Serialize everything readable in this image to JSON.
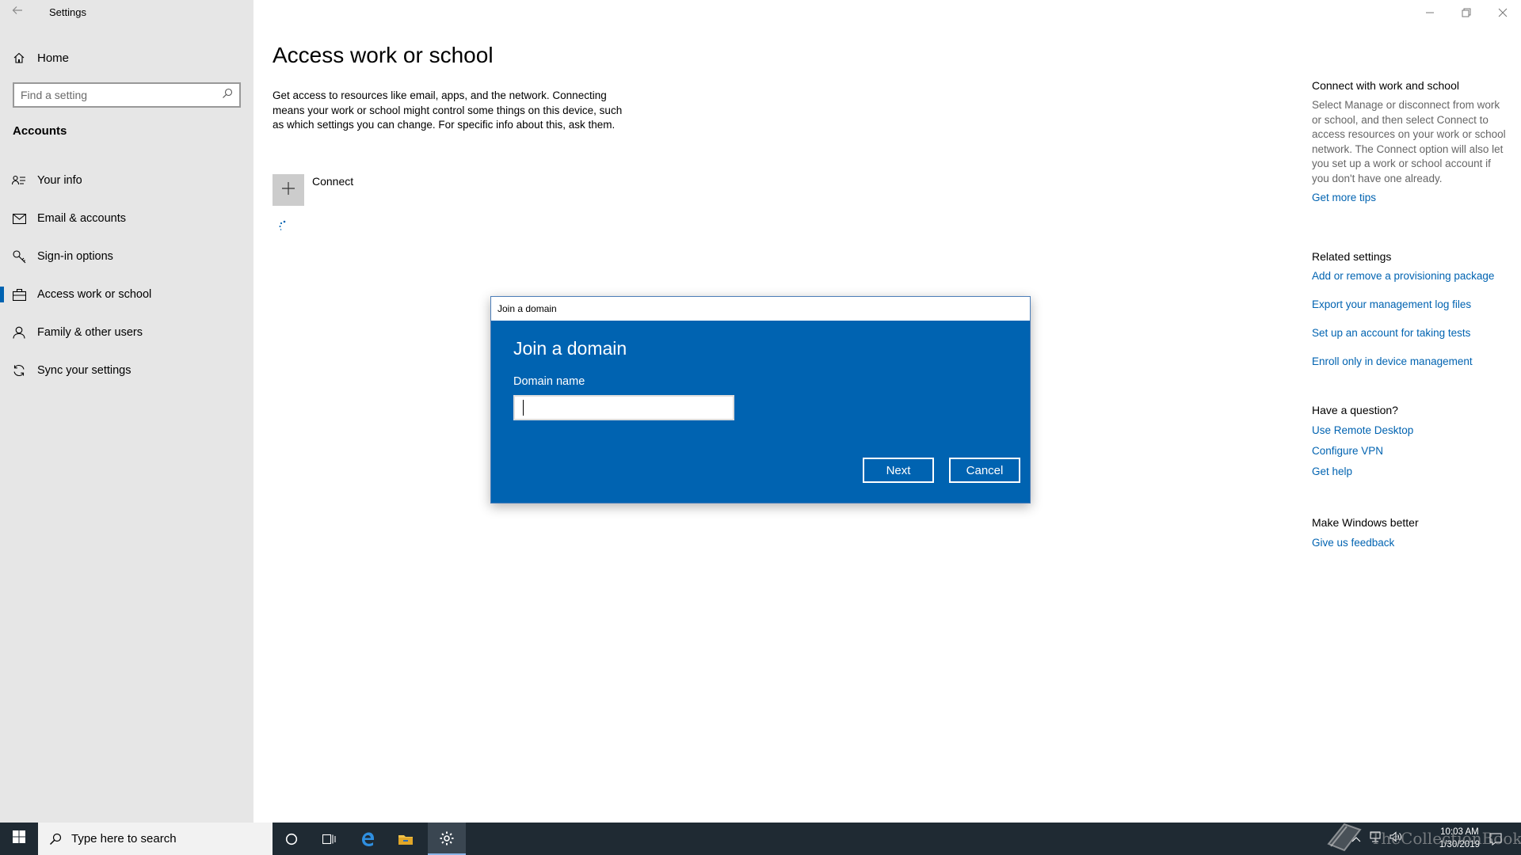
{
  "window": {
    "app_title": "Settings",
    "controls": [
      "minimize-icon",
      "restore-icon",
      "close-icon"
    ]
  },
  "sidebar": {
    "home_label": "Home",
    "search_placeholder": "Find a setting",
    "section_label": "Accounts",
    "items": [
      {
        "label": "Your info",
        "icon": "person-card-icon",
        "selected": false
      },
      {
        "label": "Email & accounts",
        "icon": "mail-icon",
        "selected": false
      },
      {
        "label": "Sign-in options",
        "icon": "key-icon",
        "selected": false
      },
      {
        "label": "Access work or school",
        "icon": "briefcase-icon",
        "selected": true
      },
      {
        "label": "Family & other users",
        "icon": "person-icon",
        "selected": false
      },
      {
        "label": "Sync your settings",
        "icon": "sync-icon",
        "selected": false
      }
    ]
  },
  "main": {
    "title": "Access work or school",
    "description": "Get access to resources like email, apps, and the network. Connecting means your work or school might control some things on this device, such as which settings you can change. For specific info about this, ask them.",
    "connect_label": "Connect"
  },
  "right": {
    "connect_heading": "Connect with work and school",
    "connect_text": "Select Manage or disconnect from work or school, and then select Connect to access resources on your work or school network. The Connect option will also let you set up a work or school account if you don't have one already.",
    "get_more_tips": "Get more tips",
    "related_heading": "Related settings",
    "related_links": [
      "Add or remove a provisioning package",
      "Export your management log files",
      "Set up an account for taking tests",
      "Enroll only in device management"
    ],
    "question_heading": "Have a question?",
    "question_links": [
      "Use Remote Desktop",
      "Configure VPN",
      "Get help"
    ],
    "better_heading": "Make Windows better",
    "feedback_link": "Give us feedback"
  },
  "dialog": {
    "window_title": "Join a domain",
    "heading": "Join a domain",
    "field_label": "Domain name",
    "field_value": "",
    "next_label": "Next",
    "cancel_label": "Cancel",
    "background_color": "#0063b1"
  },
  "taskbar": {
    "search_placeholder": "Type here to search",
    "time": "10:03 AM",
    "date": "1/30/2019",
    "watermark": "TheCollectionBook"
  },
  "colors": {
    "accent": "#0063b1",
    "sidebar_bg": "#e6e6e6",
    "taskbar_bg": "#1f2a33"
  }
}
